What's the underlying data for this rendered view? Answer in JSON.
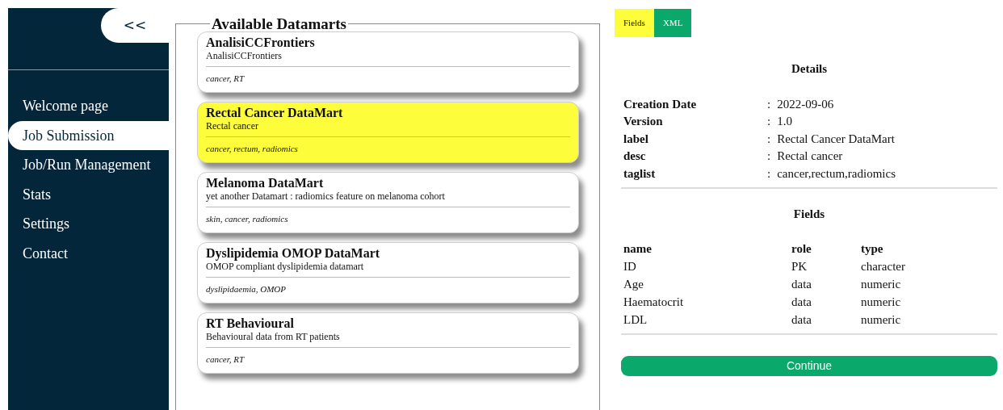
{
  "sidebar": {
    "toggle": "<<",
    "items": [
      {
        "label": "Welcome page",
        "selected": false
      },
      {
        "label": "Job Submission",
        "selected": true
      },
      {
        "label": "Job/Run Management",
        "selected": false
      },
      {
        "label": "Stats",
        "selected": false
      },
      {
        "label": "Settings",
        "selected": false
      },
      {
        "label": "Contact",
        "selected": false
      }
    ]
  },
  "datamarts": {
    "title": "Available Datamarts",
    "items": [
      {
        "name": "AnalisiCCFrontiers",
        "desc": "AnalisiCCFrontiers",
        "tags": "cancer, RT",
        "selected": false
      },
      {
        "name": "Rectal Cancer DataMart",
        "desc": "Rectal cancer",
        "tags": "cancer, rectum, radiomics",
        "selected": true
      },
      {
        "name": "Melanoma DataMart",
        "desc": "yet another Datamart : radiomics feature on melanoma cohort",
        "tags": "skin, cancer, radiomics",
        "selected": false
      },
      {
        "name": "Dyslipidemia OMOP DataMart",
        "desc": "OMOP compliant dyslipidemia datamart",
        "tags": "dyslipidaemia, OMOP",
        "selected": false
      },
      {
        "name": "RT Behavioural",
        "desc": "Behavioural data from RT patients",
        "tags": "cancer, RT",
        "selected": false
      }
    ]
  },
  "tabs": [
    {
      "label": "Fields",
      "selected": true
    },
    {
      "label": "XML",
      "selected": false
    }
  ],
  "details": {
    "title": "Details",
    "rows": [
      {
        "key": "Creation Date",
        "separator": ":",
        "value": "2022-09-06"
      },
      {
        "key": "Version",
        "separator": ":",
        "value": "1.0"
      },
      {
        "key": "label",
        "separator": ":",
        "value": "Rectal Cancer DataMart"
      },
      {
        "key": "desc",
        "separator": ":",
        "value": "Rectal cancer"
      },
      {
        "key": "taglist",
        "separator": ":",
        "value": "cancer,rectum,radiomics"
      }
    ]
  },
  "fields": {
    "title": "Fields",
    "columns": [
      "name",
      "role",
      "type"
    ],
    "rows": [
      [
        "ID",
        "PK",
        "character"
      ],
      [
        "Age",
        "data",
        "numeric"
      ],
      [
        "Haematocrit",
        "data",
        "numeric"
      ],
      [
        "LDL",
        "data",
        "numeric"
      ]
    ]
  },
  "continue_button": "Continue"
}
